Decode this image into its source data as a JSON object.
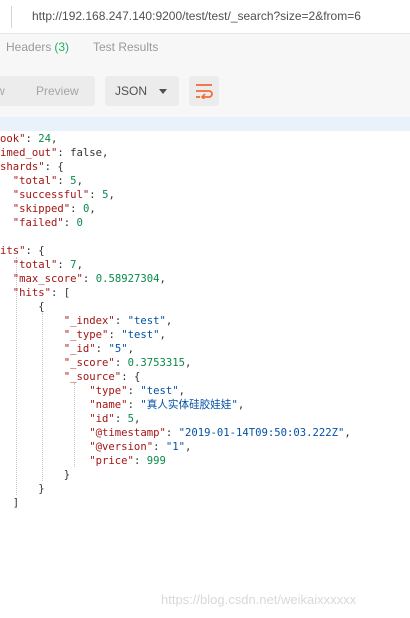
{
  "address_bar": {
    "url": "http://192.168.247.140:9200/test/test/_search?size=2&from=6"
  },
  "response_tabs": {
    "headers_label": "Headers",
    "headers_count": "(3)",
    "test_results_label": "Test Results"
  },
  "toolbar": {
    "pretty_label": "w",
    "preview_label": "Preview",
    "format_value": "JSON",
    "wrap_icon": "wrap-lines-icon",
    "accent": "#f26b3a"
  },
  "response_lines": [
    [
      {
        "t": "ook\"",
        "c": "k"
      },
      {
        "t": ": ",
        "c": "p"
      },
      {
        "t": "24",
        "c": "n"
      },
      {
        "t": ",",
        "c": "p"
      }
    ],
    [
      {
        "t": "imed_out\"",
        "c": "k"
      },
      {
        "t": ": false,",
        "c": "p"
      }
    ],
    [
      {
        "t": "shards\"",
        "c": "k"
      },
      {
        "t": ": {",
        "c": "p"
      }
    ],
    [
      {
        "t": "  \"total\"",
        "c": "k"
      },
      {
        "t": ": ",
        "c": "p"
      },
      {
        "t": "5",
        "c": "n"
      },
      {
        "t": ",",
        "c": "p"
      }
    ],
    [
      {
        "t": "  \"successful\"",
        "c": "k"
      },
      {
        "t": ": ",
        "c": "p"
      },
      {
        "t": "5",
        "c": "n"
      },
      {
        "t": ",",
        "c": "p"
      }
    ],
    [
      {
        "t": "  \"skipped\"",
        "c": "k"
      },
      {
        "t": ": ",
        "c": "p"
      },
      {
        "t": "0",
        "c": "n"
      },
      {
        "t": ",",
        "c": "p"
      }
    ],
    [
      {
        "t": "  \"failed\"",
        "c": "k"
      },
      {
        "t": ": ",
        "c": "p"
      },
      {
        "t": "0",
        "c": "n"
      }
    ],
    [
      {
        "t": "",
        "c": "p"
      }
    ],
    [
      {
        "t": "its\"",
        "c": "k"
      },
      {
        "t": ": {",
        "c": "p"
      }
    ],
    [
      {
        "t": "  \"total\"",
        "c": "k"
      },
      {
        "t": ": ",
        "c": "p"
      },
      {
        "t": "7",
        "c": "n"
      },
      {
        "t": ",",
        "c": "p"
      }
    ],
    [
      {
        "t": "  \"max_score\"",
        "c": "k"
      },
      {
        "t": ": ",
        "c": "p"
      },
      {
        "t": "0.58927304",
        "c": "n"
      },
      {
        "t": ",",
        "c": "p"
      }
    ],
    [
      {
        "t": "  \"hits\"",
        "c": "k"
      },
      {
        "t": ": [",
        "c": "p"
      }
    ],
    [
      {
        "t": "      {",
        "c": "p"
      }
    ],
    [
      {
        "t": "          \"_index\"",
        "c": "k"
      },
      {
        "t": ": ",
        "c": "p"
      },
      {
        "t": "\"test\"",
        "c": "s"
      },
      {
        "t": ",",
        "c": "p"
      }
    ],
    [
      {
        "t": "          \"_type\"",
        "c": "k"
      },
      {
        "t": ": ",
        "c": "p"
      },
      {
        "t": "\"test\"",
        "c": "s"
      },
      {
        "t": ",",
        "c": "p"
      }
    ],
    [
      {
        "t": "          \"_id\"",
        "c": "k"
      },
      {
        "t": ": ",
        "c": "p"
      },
      {
        "t": "\"5\"",
        "c": "s"
      },
      {
        "t": ",",
        "c": "p"
      }
    ],
    [
      {
        "t": "          \"_score\"",
        "c": "k"
      },
      {
        "t": ": ",
        "c": "p"
      },
      {
        "t": "0.3753315",
        "c": "n"
      },
      {
        "t": ",",
        "c": "p"
      }
    ],
    [
      {
        "t": "          \"_source\"",
        "c": "k"
      },
      {
        "t": ": {",
        "c": "p"
      }
    ],
    [
      {
        "t": "              \"type\"",
        "c": "k"
      },
      {
        "t": ": ",
        "c": "p"
      },
      {
        "t": "\"test\"",
        "c": "s"
      },
      {
        "t": ",",
        "c": "p"
      }
    ],
    [
      {
        "t": "              \"name\"",
        "c": "k"
      },
      {
        "t": ": ",
        "c": "p"
      },
      {
        "t": "\"真人实体硅胶娃娃\"",
        "c": "s"
      },
      {
        "t": ",",
        "c": "p"
      }
    ],
    [
      {
        "t": "              \"id\"",
        "c": "k"
      },
      {
        "t": ": ",
        "c": "p"
      },
      {
        "t": "5",
        "c": "n"
      },
      {
        "t": ",",
        "c": "p"
      }
    ],
    [
      {
        "t": "              \"@timestamp\"",
        "c": "k"
      },
      {
        "t": ": ",
        "c": "p"
      },
      {
        "t": "\"2019-01-14T09:50:03.222Z\"",
        "c": "s"
      },
      {
        "t": ",",
        "c": "p"
      }
    ],
    [
      {
        "t": "              \"@version\"",
        "c": "k"
      },
      {
        "t": ": ",
        "c": "p"
      },
      {
        "t": "\"1\"",
        "c": "s"
      },
      {
        "t": ",",
        "c": "p"
      }
    ],
    [
      {
        "t": "              \"price\"",
        "c": "k"
      },
      {
        "t": ": ",
        "c": "p"
      },
      {
        "t": "999",
        "c": "n"
      }
    ],
    [
      {
        "t": "          }",
        "c": "p"
      }
    ],
    [
      {
        "t": "      }",
        "c": "p"
      }
    ],
    [
      {
        "t": "  ]",
        "c": "p"
      }
    ]
  ],
  "watermark": "https://blog.csdn.net/weikaixxxxxx"
}
